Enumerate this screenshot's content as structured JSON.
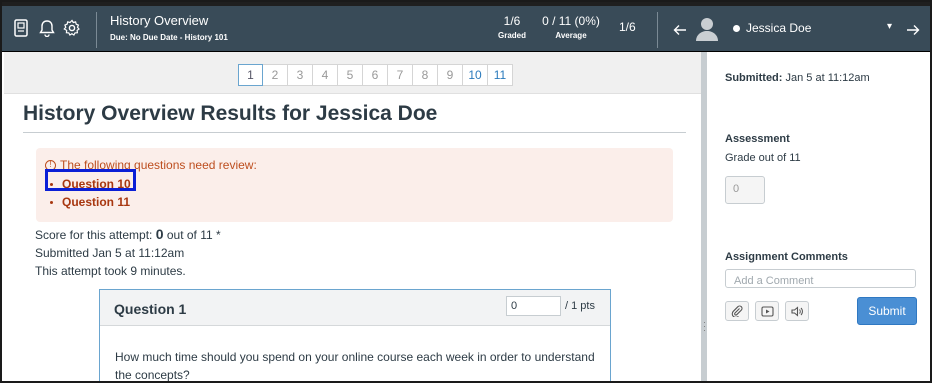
{
  "header": {
    "title": "History Overview",
    "subtitle": "Due: No Due Date - History 101",
    "graded_value": "1/6",
    "graded_label": "Graded",
    "average_value": "0 / 11 (0%)",
    "average_label": "Average",
    "student_index": "1/6",
    "student_name": "Jessica Doe",
    "dropdown_arrow": "▾"
  },
  "pager": {
    "pages": [
      "1",
      "2",
      "3",
      "4",
      "5",
      "6",
      "7",
      "8",
      "9",
      "10",
      "11"
    ],
    "active": "1",
    "flagged": [
      "10",
      "11"
    ]
  },
  "main": {
    "title": "History Overview Results for Jessica Doe",
    "review_heading": "The following questions need review:",
    "review_items": [
      "Question 10",
      "Question 11"
    ],
    "score_prefix": "Score for this attempt: ",
    "score_value": "0",
    "score_suffix": " out of 11 *",
    "submitted": "Submitted Jan 5 at 11:12am",
    "duration": "This attempt took 9 minutes.",
    "question": {
      "title": "Question 1",
      "points_value": "0",
      "points_label": "/ 1 pts",
      "text": "How much time should you spend on your online course each week in order to understand the concepts?"
    }
  },
  "sidebar": {
    "submitted_label": "Submitted:",
    "submitted_value": " Jan 5 at 11:12am",
    "assessment_heading": "Assessment",
    "grade_label": "Grade out of 11",
    "grade_value": "0",
    "comments_heading": "Assignment Comments",
    "comment_placeholder": "Add a Comment",
    "submit_label": "Submit"
  },
  "colors": {
    "topbar": "#394b58",
    "review_bg": "#fbeeea",
    "review_text": "#a83710",
    "highlight": "#0b1fd6",
    "submit": "#4a8fd4"
  }
}
